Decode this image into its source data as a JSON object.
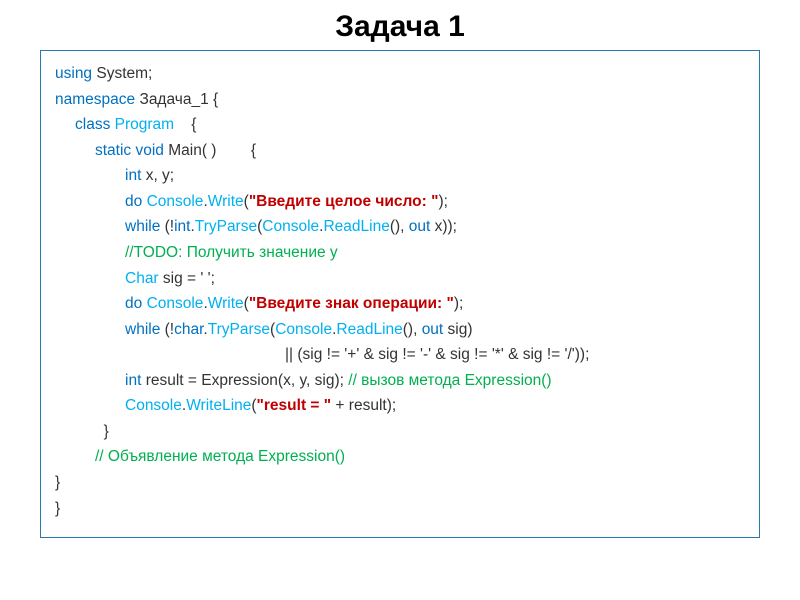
{
  "title": "Задача 1",
  "code": {
    "l1a": "using ",
    "l1b": "System;",
    "l2a": "namespace ",
    "l2b": "Задача_1 {",
    "l3a": "class ",
    "l3b": "Program",
    "l3c": "    {",
    "l4a": "static void ",
    "l4b": "Main( )        {",
    "l5a": "int ",
    "l5b": "x, y;",
    "l6a": "do ",
    "l6b": "Console",
    "l6c": ".",
    "l6d": "Write",
    "l6e": "(",
    "l6f": "\"Введите целое число: \"",
    "l6g": ");",
    "l7a": "while ",
    "l7b": "(!",
    "l7c": "int",
    "l7d": ".",
    "l7e": "TryParse",
    "l7f": "(",
    "l7g": "Console",
    "l7h": ".",
    "l7i": "ReadLine",
    "l7j": "(), ",
    "l7k": "out ",
    "l7l": "x));",
    "l8": "//TODO: Получить значение у",
    "l9a": "char ",
    "l9b": "Char ",
    "l9c": "sig = ' ';",
    "l10a": "do ",
    "l10b": "Console",
    "l10c": ".",
    "l10d": "Write",
    "l10e": "(",
    "l10f": "\"Введите знак операции: \"",
    "l10g": ");",
    "l11a": "while ",
    "l11b": "(!",
    "l11c": "char",
    "l11d": ".",
    "l11e": "TryParse",
    "l11f": "(",
    "l11g": "Console",
    "l11h": ".",
    "l11i": "ReadLine",
    "l11j": "(), ",
    "l11k": "out ",
    "l11l": "sig)",
    "l12": "|| (sig != '+' & sig != '-' & sig != '*' & sig != '/'));",
    "l13a": "int ",
    "l13b": "result = Expression(x, y, sig); ",
    "l13c": "// вызов метода Expression()",
    "l14a": "Console",
    "l14b": ".",
    "l14c": "WriteLine",
    "l14d": "(",
    "l14e": "\"result = \"",
    "l14f": " + result);",
    "l15": "  }",
    "l16": "// Объявление метода Expression()",
    "l17": "}",
    "l18": "}"
  }
}
